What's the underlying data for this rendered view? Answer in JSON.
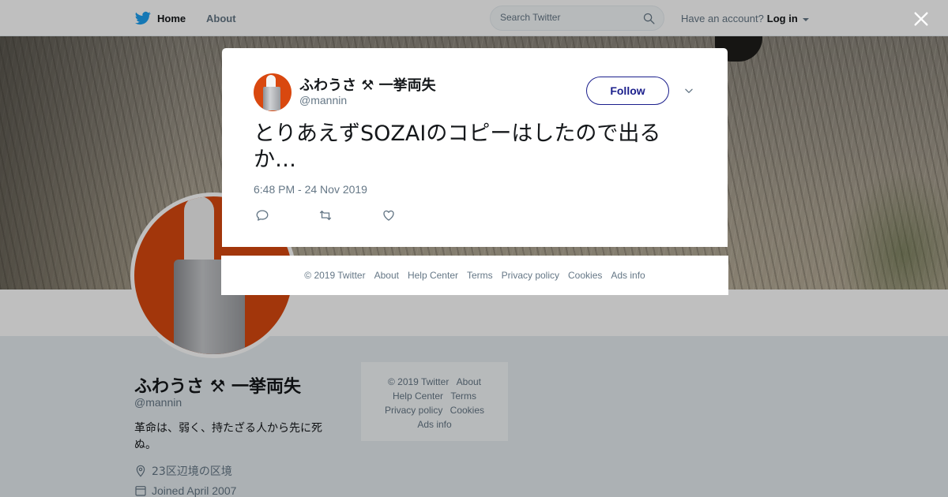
{
  "topbar": {
    "home_label": "Home",
    "about_label": "About",
    "search_placeholder": "Search Twitter",
    "account_prompt": "Have an account?",
    "login_label": "Log in"
  },
  "profile": {
    "name": "ふわうさ ⚒ 一挙両失",
    "handle": "@mannin",
    "bio": "革命は、弱く、持たざる人から先に死ぬ。",
    "location": "23区辺境の区境",
    "joined": "Joined April 2007"
  },
  "side_footer": {
    "items": [
      "© 2019 Twitter",
      "About",
      "Help Center",
      "Terms",
      "Privacy policy",
      "Cookies",
      "Ads info"
    ]
  },
  "tweet": {
    "author_name": "ふわうさ ⚒ 一挙両失",
    "author_handle": "@mannin",
    "follow_label": "Follow",
    "text": "とりあえずSOZAIのコピーはしたので出るか…",
    "timestamp": "6:48 PM - 24 Nov 2019"
  },
  "modal_footer": {
    "items": [
      "© 2019 Twitter",
      "About",
      "Help Center",
      "Terms",
      "Privacy policy",
      "Cookies",
      "Ads info"
    ]
  },
  "colors": {
    "brand": "#1da1f2",
    "follow": "#1b1f8c",
    "avatar_bg": "#d9480f",
    "muted_text": "#657786"
  },
  "icons": [
    "twitter-bird-icon",
    "search-icon",
    "close-icon",
    "chevron-down-icon",
    "reply-icon",
    "retweet-icon",
    "like-icon",
    "location-icon",
    "calendar-icon"
  ]
}
